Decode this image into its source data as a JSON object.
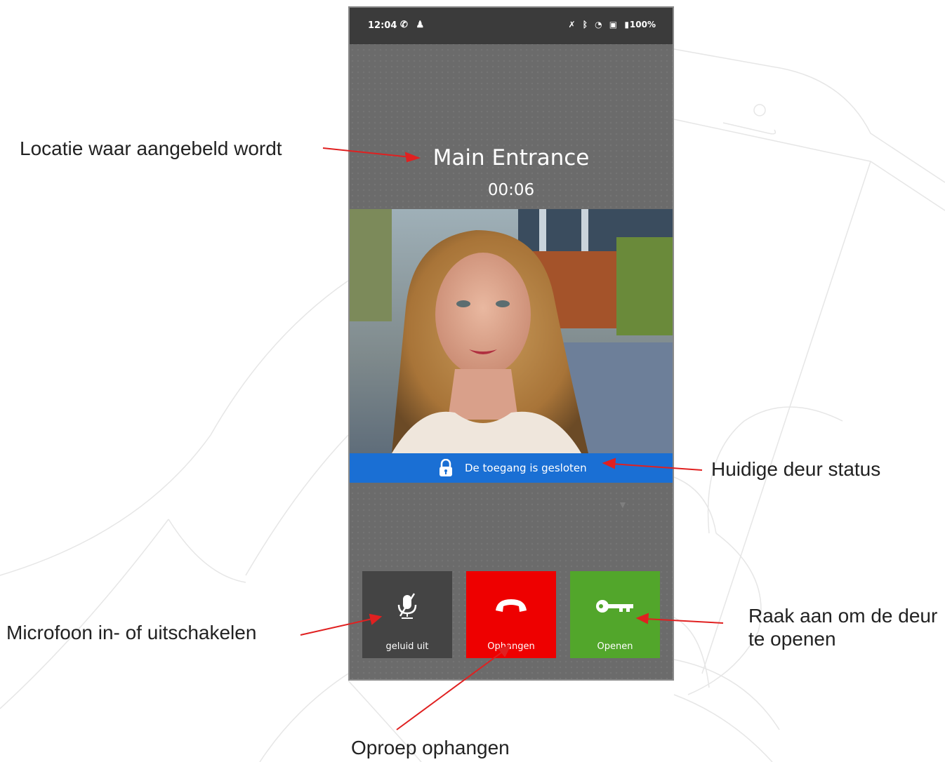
{
  "statusbar": {
    "time": "12:04",
    "left_icons": [
      "call-icon",
      "person-icon"
    ],
    "right_icons": [
      "bell-off-icon",
      "bluetooth-icon",
      "wifi-icon",
      "sim-icon",
      "battery-icon"
    ],
    "battery": "100%"
  },
  "call": {
    "location": "Main Entrance",
    "duration": "00:06"
  },
  "door_status": {
    "text": "De toegang is gesloten",
    "color": "#1a6fd4"
  },
  "buttons": {
    "mute_label": "geluid uit",
    "hangup_label": "Ophangen",
    "open_label": "Openen",
    "colors": {
      "mute": "#444444",
      "hangup": "#ee0000",
      "open": "#52a62b"
    }
  },
  "annotations": {
    "location": "Locatie waar aangebeld wordt",
    "door_status": "Huidige deur status",
    "microphone": "Microfoon in- of uitschakelen",
    "open_line1": "Raak aan om de deur",
    "open_line2": "te openen",
    "hangup": "Oproep ophangen",
    "arrow_color": "#e02020"
  }
}
